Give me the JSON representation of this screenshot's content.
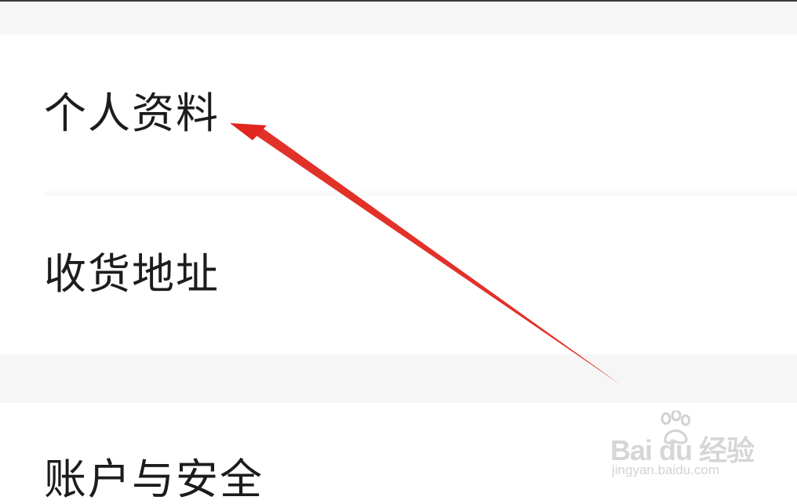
{
  "settings": {
    "items": [
      {
        "label": "个人资料"
      },
      {
        "label": "收货地址"
      },
      {
        "label": "账户与安全"
      }
    ]
  },
  "watermark": {
    "brand": "Bai du 经验",
    "url": "jingyan.baidu.com"
  },
  "colors": {
    "annotation_arrow": "#e0261e",
    "section_gap": "#f6f6f6",
    "text": "#1c1c1c"
  }
}
